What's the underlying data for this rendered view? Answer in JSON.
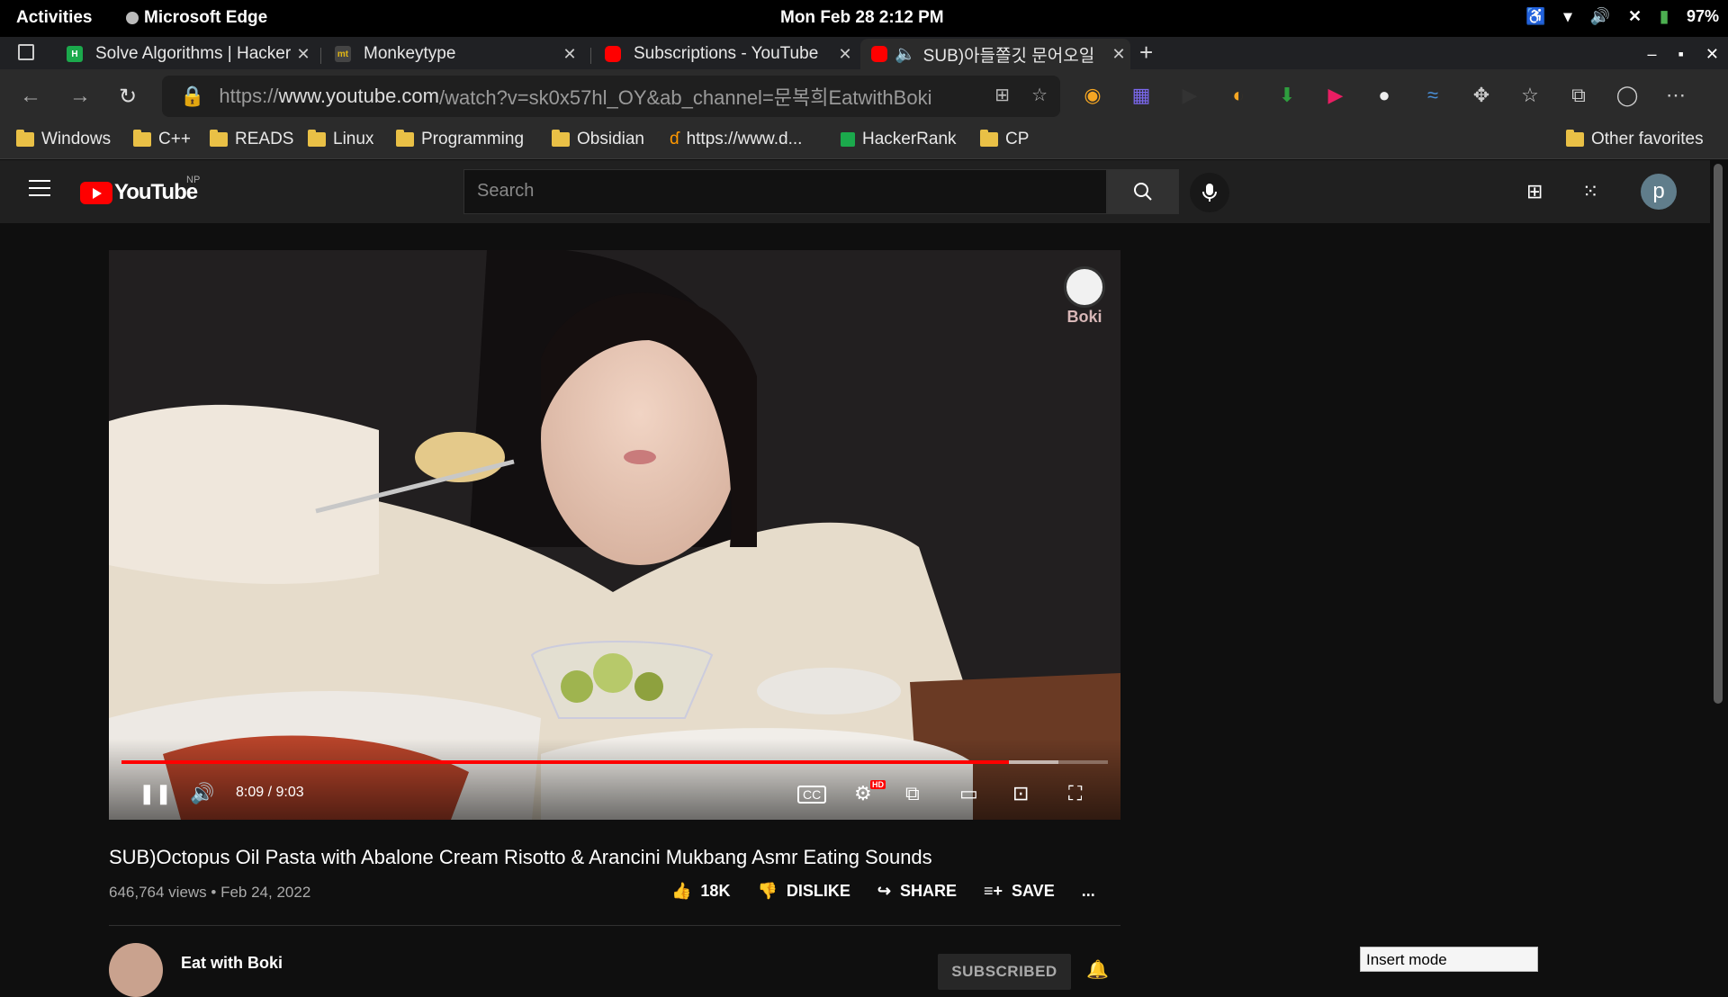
{
  "system": {
    "activities": "Activities",
    "app_name": "Microsoft Edge",
    "clock": "Mon Feb 28  2:12 PM",
    "battery": "97%"
  },
  "tabs": [
    {
      "title": "Solve Algorithms | HackerRank",
      "favicon": "H",
      "favicon_color": "#1ba94c"
    },
    {
      "title": "Monkeytype",
      "favicon": "mt",
      "favicon_color": "#444444"
    },
    {
      "title": "Subscriptions - YouTube",
      "favicon": "yt",
      "favicon_color": "#ff0000"
    },
    {
      "title": "SUB)아들쫄깃 문어오일",
      "favicon": "yt",
      "favicon_color": "#ff0000"
    }
  ],
  "address": {
    "url_prefix": "https://",
    "url_domain": "www.youtube.com",
    "url_path": "/watch?v=sk0x57hl_OY&ab_channel=문복희EatwithBoki"
  },
  "bookmarks": [
    {
      "label": "Windows",
      "type": "folder"
    },
    {
      "label": "C++",
      "type": "folder"
    },
    {
      "label": "READS",
      "type": "folder"
    },
    {
      "label": "Linux",
      "type": "folder"
    },
    {
      "label": "Programming",
      "type": "folder"
    },
    {
      "label": "Obsidian",
      "type": "folder"
    },
    {
      "label": "https://www.d...",
      "type": "link"
    },
    {
      "label": "HackerRank",
      "type": "link"
    },
    {
      "label": "CP",
      "type": "folder"
    }
  ],
  "other_favorites": "Other favorites",
  "youtube": {
    "logo_text": "YouTube",
    "region": "NP",
    "search_placeholder": "Search",
    "avatar_letter": "p"
  },
  "player": {
    "time": "8:09 / 9:03",
    "progress": 0.9,
    "buffered": 0.95,
    "channel_watermark": "Boki",
    "hd_badge": "HD"
  },
  "video": {
    "title": "SUB)Octopus Oil Pasta with Abalone Cream Risotto & Arancini Mukbang Asmr Eating Sounds",
    "views_date": "646,764 views • Feb 24, 2022",
    "likes": "18K",
    "dislike": "DISLIKE",
    "share": "SHARE",
    "save": "SAVE",
    "more": "..."
  },
  "channel": {
    "name": "Eat with Boki",
    "subscribe": "SUBSCRIBED"
  },
  "status": {
    "mode": "Insert mode"
  }
}
